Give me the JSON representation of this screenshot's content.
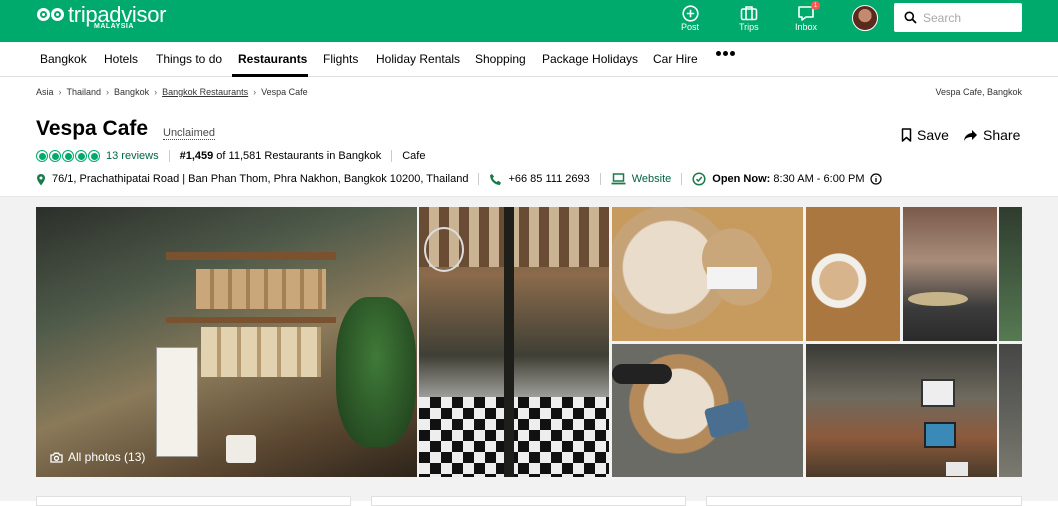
{
  "header": {
    "logo_text": "tripadvisor",
    "logo_region": "MALAYSIA",
    "nav": [
      {
        "label": "Post",
        "icon": "plus-circle-icon"
      },
      {
        "label": "Trips",
        "icon": "suitcase-icon"
      },
      {
        "label": "Inbox",
        "icon": "chat-bubble-icon",
        "badge": "1"
      }
    ],
    "search_placeholder": "Search",
    "brand_color": "#00aa6c"
  },
  "categories": [
    "Bangkok",
    "Hotels",
    "Things to do",
    "Restaurants",
    "Flights",
    "Holiday Rentals",
    "Shopping",
    "Package Holidays",
    "Car Hire"
  ],
  "active_category": "Restaurants",
  "breadcrumb": [
    "Asia",
    "Thailand",
    "Bangkok",
    "Bangkok Restaurants",
    "Vespa Cafe"
  ],
  "breadcrumb_right": "Vespa Cafe, Bangkok",
  "listing": {
    "name": "Vespa Cafe",
    "claim_status": "Unclaimed",
    "save_label": "Save",
    "share_label": "Share",
    "rating_bubbles": 5,
    "reviews": "13 reviews",
    "rank": "#1,459",
    "rank_suffix": "of 11,581 Restaurants in Bangkok",
    "cuisine": "Cafe",
    "address": "76/1, Prachathipatai Road | Ban Phan Thom, Phra Nakhon, Bangkok 10200, Thailand",
    "phone": "+66 85 111 2693",
    "website_label": "Website",
    "open_label": "Open Now:",
    "hours": "8:30 AM - 6:00 PM"
  },
  "photos": {
    "all_photos_label": "All photos (13)"
  }
}
